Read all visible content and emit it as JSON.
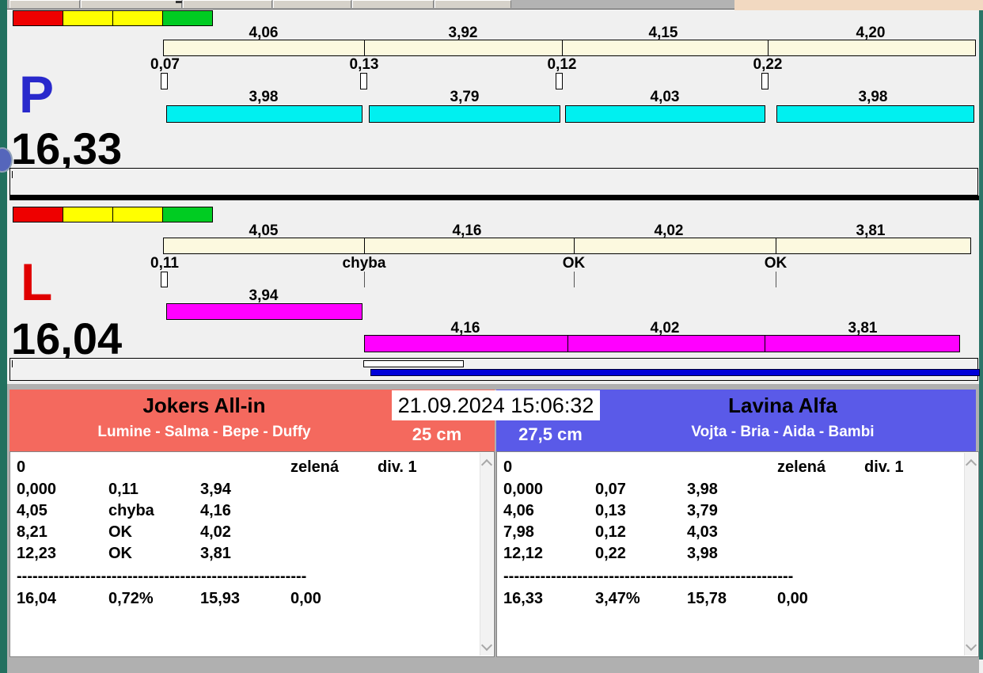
{
  "timestamp": "21.09.2024 15:06:32",
  "traffic_lights": [
    "#ee0000",
    "#ffff00",
    "#ffff00",
    "#00cc22"
  ],
  "colors": {
    "lane_p_letter": "#2929cc",
    "lane_l_letter": "#e00000",
    "segment_bar": "#fcf9df",
    "p_speed_bar": "#00f0f0",
    "l_speed_bar": "#ff00ff",
    "progress_bar": "#0000d9",
    "team_left_header": "#f4695e",
    "team_right_header": "#5a5ae8"
  },
  "lanes": {
    "p": {
      "label": "P",
      "total": "16,33",
      "top_values": [
        "4,06",
        "3,92",
        "4,15",
        "4,20"
      ],
      "splits": [
        "0,07",
        "0,13",
        "0,12",
        "0,22"
      ],
      "bottom_values": [
        "3,98",
        "3,79",
        "4,03",
        "3,98"
      ]
    },
    "l": {
      "label": "L",
      "total": "16,04",
      "top_values": [
        "4,05",
        "4,16",
        "4,02",
        "3,81"
      ],
      "splits": [
        "0,11",
        "chyba",
        "OK",
        "OK"
      ],
      "first_split_value": "3,94",
      "bottom_values": [
        "4,16",
        "4,02",
        "3,81"
      ]
    }
  },
  "teams": {
    "left": {
      "name": "Jokers All-in",
      "members": "Lumine - Salma - Bepe - Duffy",
      "jump_height": "25 cm",
      "table": {
        "first_row": {
          "col1": "0",
          "status": "zelená",
          "division": "div. 1"
        },
        "rows": [
          [
            "0,000",
            "0,11",
            "3,94"
          ],
          [
            "4,05",
            "chyba",
            "4,16"
          ],
          [
            "8,21",
            "OK",
            "4,02"
          ],
          [
            "12,23",
            "OK",
            "3,81"
          ]
        ],
        "separator": "-------------------------------------------------------",
        "totals": [
          "16,04",
          "0,72%",
          "15,93",
          "0,00"
        ]
      }
    },
    "right": {
      "name": "Lavina Alfa",
      "members": "Vojta - Bria - Aida - Bambi",
      "jump_height": "27,5 cm",
      "table": {
        "first_row": {
          "col1": "0",
          "status": "zelená",
          "division": "div. 1"
        },
        "rows": [
          [
            "0,000",
            "0,07",
            "3,98"
          ],
          [
            "4,06",
            "0,13",
            "3,79"
          ],
          [
            "7,98",
            "0,12",
            "4,03"
          ],
          [
            "12,12",
            "0,22",
            "3,98"
          ]
        ],
        "separator": "-------------------------------------------------------",
        "totals": [
          "16,33",
          "3,47%",
          "15,78",
          "0,00"
        ]
      }
    }
  }
}
